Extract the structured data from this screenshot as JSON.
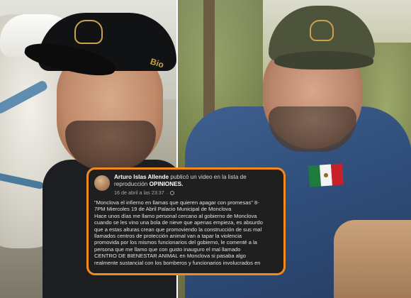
{
  "post": {
    "author": "Arturo Islas Allende",
    "action_text": "publicó un video en la lista de reproducción",
    "playlist": "OPINIONES.",
    "timestamp": "16 de abril a las 23:37",
    "separator": "·",
    "icon": "globe-icon",
    "body_lines": [
      "\"Monclova el infierno en llamas que quieren apagar con promesas\" 8-",
      "7PM Miercoles 19 de Abril Palacio Municipal de Monclova",
      "Hace unos días me llamo personal cercano al gobierno de Monclova",
      "cuando se les vino una bola de nieve que apenas empieza, es absurdo",
      "que a estas alturas crean que promoviendo la construcción de sus mal",
      "llamados centros de protección animal van a tapar la violencia",
      "promovida por los mismos funcionarios del gobierno, le comenté a la",
      "persona que me llamo que con gusto inauguro el mal llamado",
      "CENTRO DE BIENESTAR ANIMAL en Monclova si pasaba algo",
      "realmente sustancial con los bomberos y funcionarios involucrados en"
    ]
  },
  "photos": {
    "left_cap_text": "Bio",
    "colors": {
      "accent_border": "#f08a1e",
      "card_bg": "#1f1f1f",
      "cap_logo": "#c9a24a"
    }
  }
}
